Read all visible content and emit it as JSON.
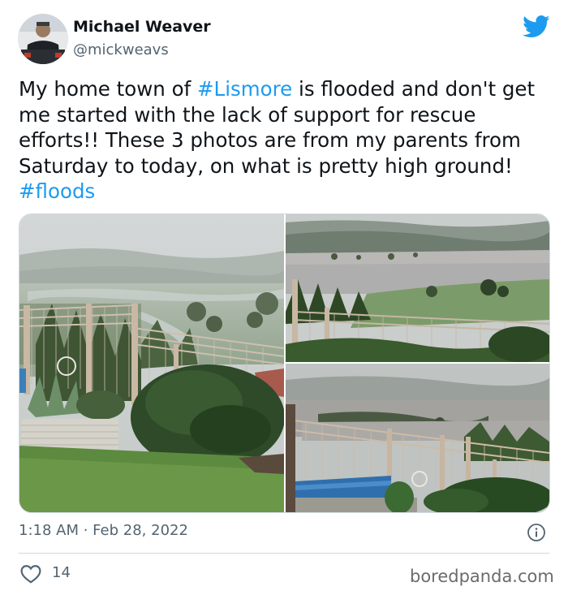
{
  "author": {
    "name": "Michael Weaver",
    "handle": "@mickweavs"
  },
  "tweet": {
    "text_1": "My home town of ",
    "hashtag_1": "#Lismore",
    "text_2": " is flooded and don't get me started with the lack of support for rescue efforts!! These 3 photos are from my parents from Saturday to today, on what is pretty high ground!",
    "hashtag_2": "#floods"
  },
  "media": {
    "photos": [
      "flood-garden-photo",
      "flood-river-photo",
      "flood-fence-photo"
    ]
  },
  "meta": {
    "time": "1:18 AM",
    "separator": " · ",
    "date": "Feb 28, 2022"
  },
  "engagement": {
    "likes": "14"
  },
  "watermark": "boredpanda.com",
  "icons": {
    "brand": "twitter-bird-icon",
    "info": "info-icon",
    "like": "heart-icon"
  },
  "colors": {
    "link": "#1d9bf0",
    "secondary_text": "#536471",
    "brand": "#1d9bf0"
  }
}
